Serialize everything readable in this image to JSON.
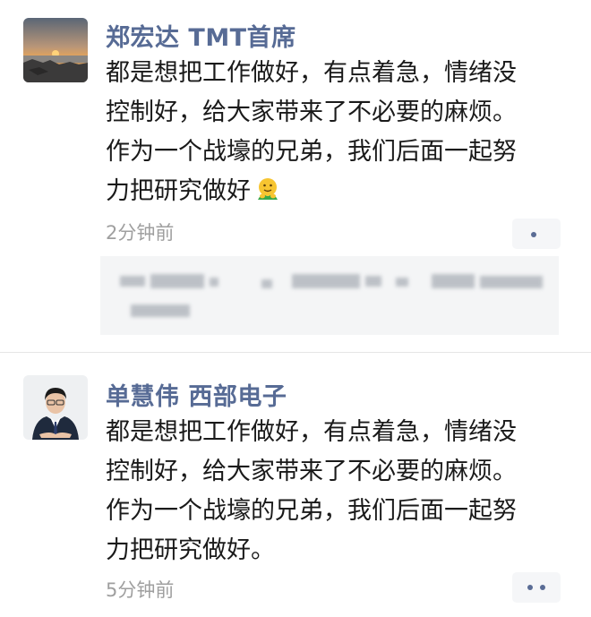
{
  "posts": [
    {
      "author": "郑宏达 TMT首席",
      "lines": [
        "都是想把工作做好，有点着急，情绪没",
        "控制好，给大家带来了不必要的麻烦。",
        "作为一个战壕的兄弟，我们后面一起努",
        "力把研究做好"
      ],
      "trailing_emoji": "hug-emoji",
      "timestamp": "2分钟前",
      "avatar_icon": "sunset-avatar",
      "has_comment_preview": true
    },
    {
      "author": "单慧伟  西部电子",
      "lines": [
        "都是想把工作做好，有点着急，情绪没",
        "控制好，给大家带来了不必要的麻烦。",
        "作为一个战壕的兄弟，我们后面一起努",
        "力把研究做好。"
      ],
      "timestamp": "5分钟前",
      "avatar_icon": "person-in-suit-avatar"
    }
  ],
  "colors": {
    "author_name": "#576b95",
    "body_text": "#1a1a1a",
    "timestamp": "#9f9f9f",
    "comment_bg": "#f4f5f6"
  }
}
